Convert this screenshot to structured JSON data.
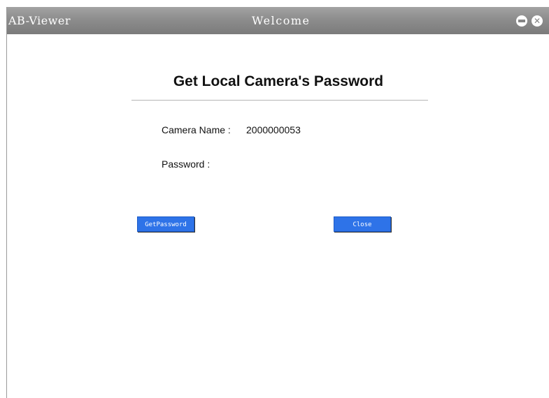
{
  "window": {
    "app_name": "AB-Viewer",
    "title": "Welcome",
    "minimize_icon": "minimize-icon",
    "close_icon": "close-icon"
  },
  "dialog": {
    "heading": "Get Local Camera's Password",
    "camera_name_label": "Camera Name :",
    "camera_name_value": "2000000053",
    "password_label": "Password :",
    "password_value": ""
  },
  "buttons": {
    "get_password": "GetPassword",
    "close": "Close"
  },
  "colors": {
    "titlebar": "#8d8d8d",
    "button_blue": "#2e73e8",
    "title_text": "#ffffff"
  }
}
